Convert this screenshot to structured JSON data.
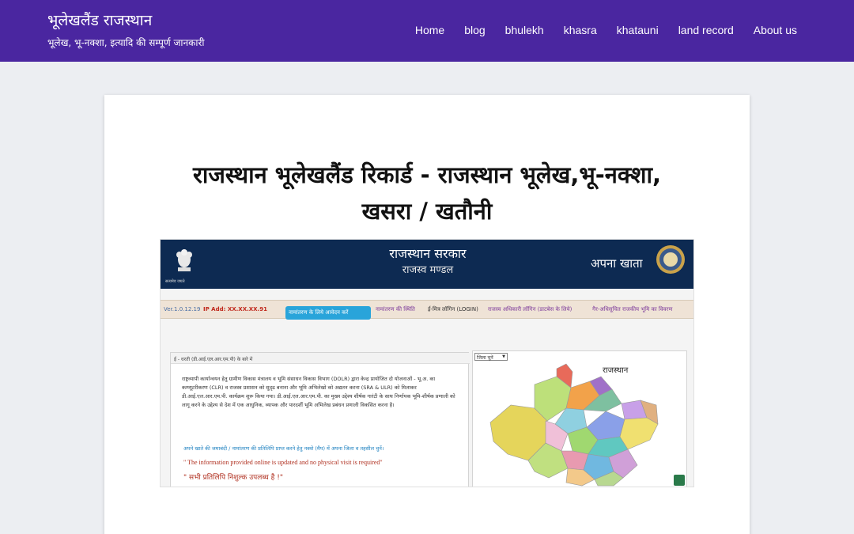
{
  "site": {
    "title": "भूलेखलैंड राजस्थान",
    "tagline": "भूलेख, भू-नक्शा, इत्यादि की सम्पूर्ण जानकारी"
  },
  "nav": {
    "items": [
      {
        "label": "Home"
      },
      {
        "label": "blog"
      },
      {
        "label": "bhulekh"
      },
      {
        "label": "khasra"
      },
      {
        "label": "khatauni"
      },
      {
        "label": "land record"
      },
      {
        "label": "About us"
      }
    ]
  },
  "post": {
    "title_line1": "राजस्थान भूलेखलैंड रिकार्ड - राजस्थान भूलेख,भू-नक्शा,",
    "title_line2": "खसरा / खतौनी"
  },
  "screenshot": {
    "gov_name": "राजस्थान सरकार",
    "gov_sub": "राजस्व मण्डल",
    "apna_khata": "अपना खाता",
    "emblem_caption": "सत्यमेव जयते",
    "version": "Ver.1.0.12.19",
    "ip": "IP Add: XX.XX.XX.91",
    "sub_nav": {
      "apply": "नामांतरण के लिये आवेदन करें",
      "status": "नामांतरण की स्थिति",
      "emitra": "ई-मित्र लॉगिन (LOGIN)",
      "officer": "राजस्व अधिकारी लॉगिन (डाटबेस के लिये)",
      "nonagri": "गैर-अधिसूचित राजकीय भूमि का विवरण"
    },
    "info_head": "ई - धरती (डी.आई.एल.आर.एम.पी) के बारे में",
    "info_para": "राष्ट्रव्यापी कार्यान्वयन हेतु ग्रामीण विकास मंत्रालय व भूमि संसाधन विकास विभाग (DOLR) द्वारा केन्द्र प्रायोजित दो योजनाओं - भू.अ. का कम्प्यूटरीकरण (CLR) व राजस्व प्रशासन को सुदृढ बनाना और भूमि अभिलेखो को अद्यतन करना (SRA & ULR) को मिलाकर डी.आई.एल.आर.एम.पी. कार्यक्रम शुरू किया गया। डी.आई.एल.आर.एम.पी. का मुख्य उद्देश्य शीर्षक गारंटी के साथ निर्णायक भूमि-शीर्षक प्रणाली को लागू करने के उद्देश्य से देश में एक आधुनिक, व्यापक और पारदर्शी भूमि अभिलेख प्रबंधन प्रणाली विकसित करना है।",
    "info_prompt": "अपने खाते की जमाबंदी / नामांतरण की प्रतिलिपि प्राप्त करने हेतु नक्शे (मैप) में अपना जिला व तहसील चुनें।",
    "info_en": "\" The information provided online is updated and no physical visit is required\"",
    "info_hi": "\" सभी प्रतिलिपि निशुल्क उपलब्ध है !\"",
    "district_select": "जिला चुनें",
    "map_title": "राजस्थान"
  }
}
